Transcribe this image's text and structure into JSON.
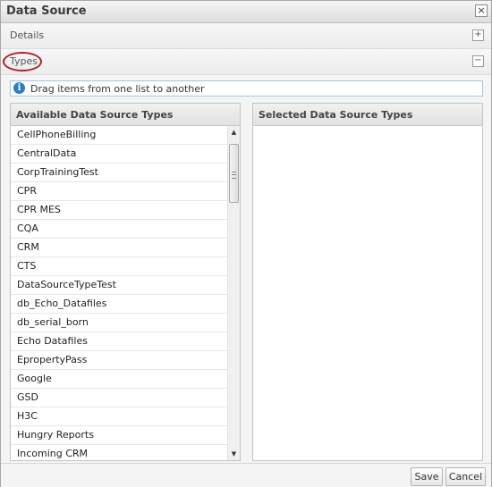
{
  "dialog": {
    "title": "Data Source",
    "close_glyph": "×",
    "close_icon": "close-icon"
  },
  "sections": {
    "details": {
      "label": "Details",
      "toggle_glyph": "+",
      "toggle_icon": "expand-plus-icon"
    },
    "types": {
      "label": "Types",
      "toggle_glyph": "−",
      "toggle_icon": "collapse-minus-icon",
      "highlight_color": "#b21f2d"
    }
  },
  "info": {
    "icon_glyph": "i",
    "icon": "info-icon",
    "text": "Drag items from one list to another"
  },
  "available": {
    "title": "Available Data Source Types",
    "items": [
      "CellPhoneBilling",
      "CentralData",
      "CorpTrainingTest",
      "CPR",
      "CPR MES",
      "CQA",
      "CRM",
      "CTS",
      "DataSourceTypeTest",
      "db_Echo_Datafiles",
      "db_serial_born",
      "Echo Datafiles",
      "EpropertyPass",
      "Google",
      "GSD",
      "H3C",
      "Hungry Reports",
      "Incoming CRM"
    ],
    "scroll_up_glyph": "▲",
    "scroll_down_glyph": "▼"
  },
  "selected": {
    "title": "Selected Data Source Types",
    "items": []
  },
  "footer": {
    "save_label": "Save",
    "cancel_label": "Cancel"
  },
  "colors": {
    "info_icon": "#2f7cc4",
    "highlight_ring": "#b21f2d"
  }
}
